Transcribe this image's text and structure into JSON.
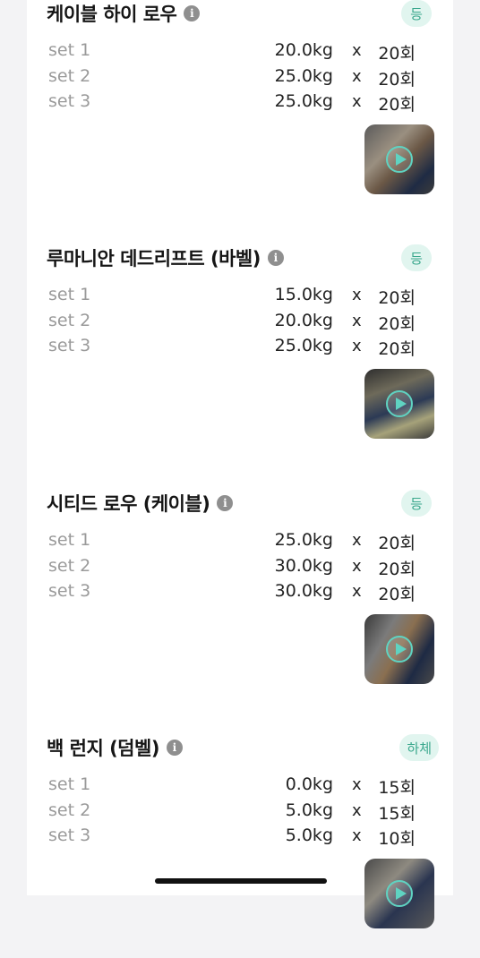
{
  "exercises": [
    {
      "name": "케이블 하이 로우",
      "tag": "등",
      "sets": [
        {
          "label": "set 1",
          "weight": "20.0kg",
          "x": "x",
          "reps": "20회"
        },
        {
          "label": "set 2",
          "weight": "25.0kg",
          "x": "x",
          "reps": "20회"
        },
        {
          "label": "set 3",
          "weight": "25.0kg",
          "x": "x",
          "reps": "20회"
        }
      ]
    },
    {
      "name": "루마니안 데드리프트 (바벨)",
      "tag": "등",
      "sets": [
        {
          "label": "set 1",
          "weight": "15.0kg",
          "x": "x",
          "reps": "20회"
        },
        {
          "label": "set 2",
          "weight": "20.0kg",
          "x": "x",
          "reps": "20회"
        },
        {
          "label": "set 3",
          "weight": "25.0kg",
          "x": "x",
          "reps": "20회"
        }
      ]
    },
    {
      "name": "시티드 로우 (케이블)",
      "tag": "등",
      "sets": [
        {
          "label": "set 1",
          "weight": "25.0kg",
          "x": "x",
          "reps": "20회"
        },
        {
          "label": "set 2",
          "weight": "30.0kg",
          "x": "x",
          "reps": "20회"
        },
        {
          "label": "set 3",
          "weight": "30.0kg",
          "x": "x",
          "reps": "20회"
        }
      ]
    },
    {
      "name": "백 런지 (덤벨)",
      "tag": "하체",
      "sets": [
        {
          "label": "set 1",
          "weight": "0.0kg",
          "x": "x",
          "reps": "15회"
        },
        {
          "label": "set 2",
          "weight": "5.0kg",
          "x": "x",
          "reps": "15회"
        },
        {
          "label": "set 3",
          "weight": "5.0kg",
          "x": "x",
          "reps": "10회"
        }
      ]
    }
  ],
  "info_icon": "i",
  "colors": {
    "tag_bg": "#e1f5ef",
    "tag_text": "#3aa88d",
    "play": "#5fd3c2"
  }
}
